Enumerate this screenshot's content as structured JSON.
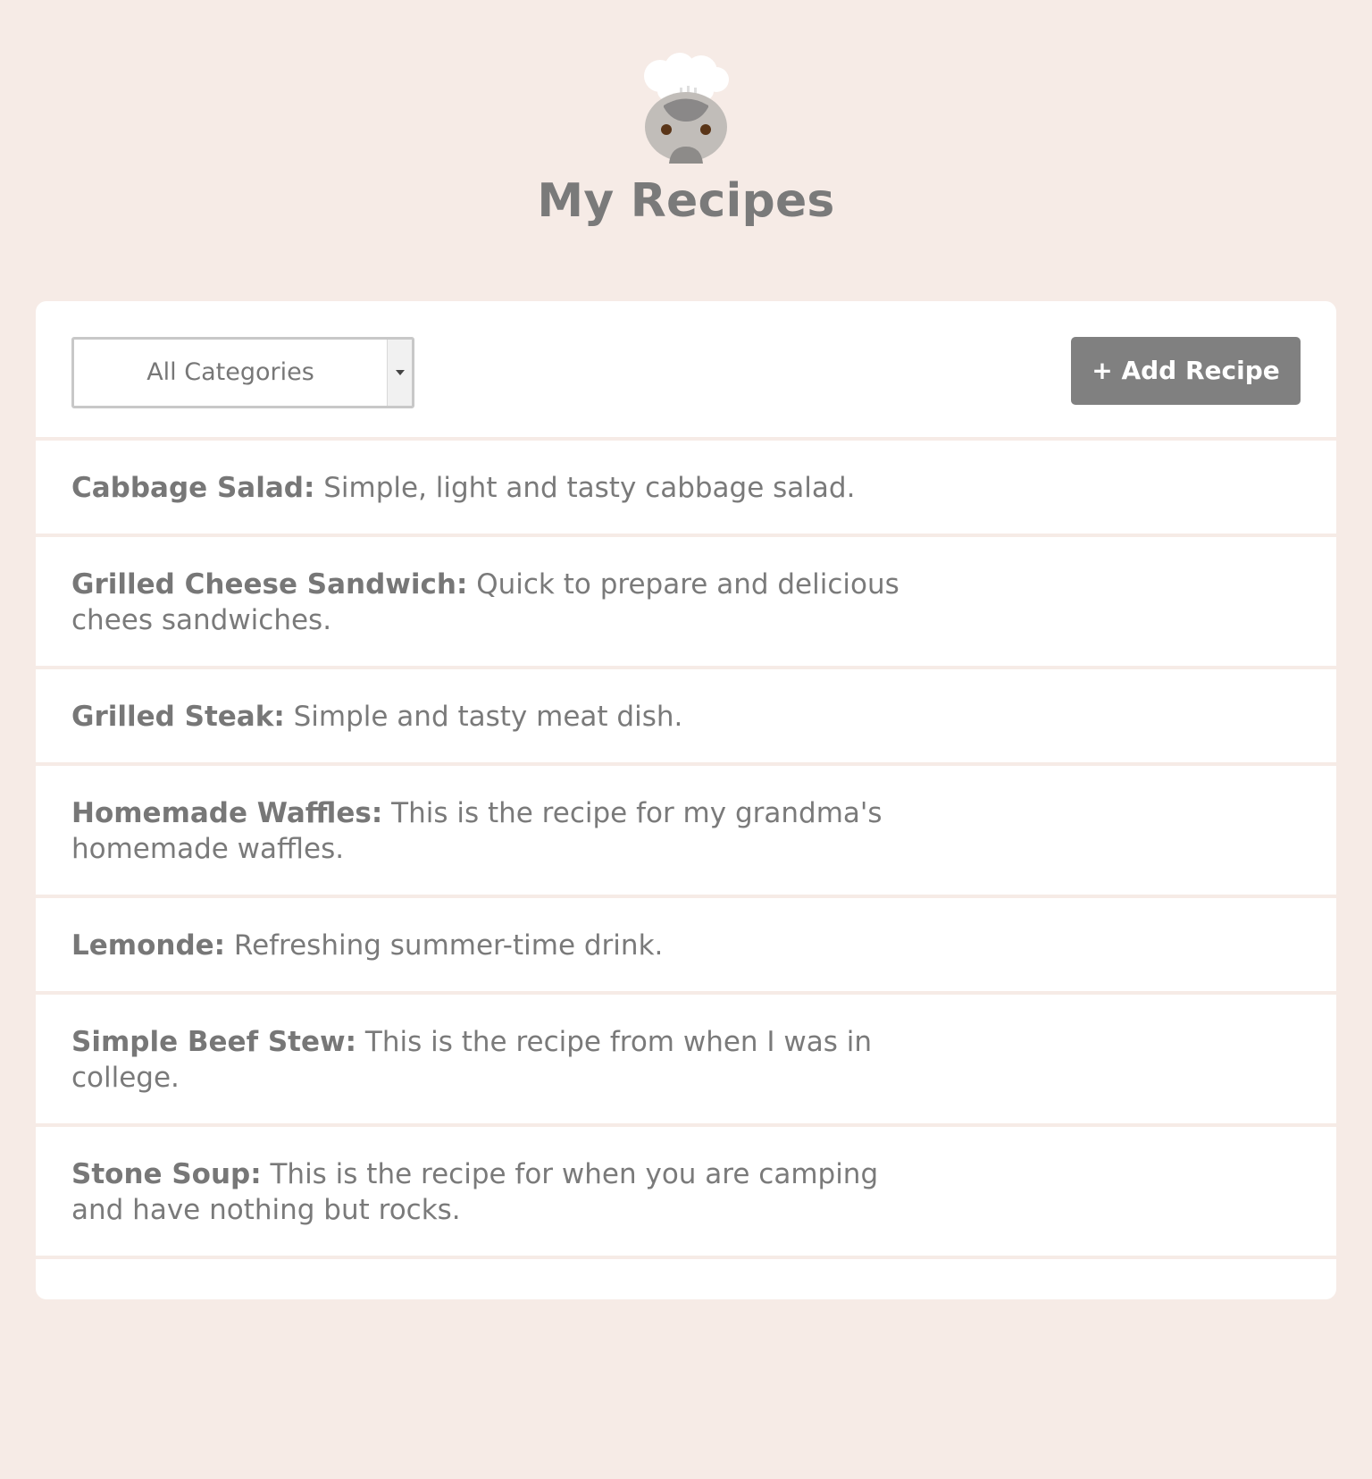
{
  "app": {
    "title": "My Recipes",
    "logo_icon": "chef-hat-icon"
  },
  "toolbar": {
    "category_filter": {
      "selected_label": "All Categories"
    },
    "add_recipe_label": "+ Add Recipe"
  },
  "recipes": [
    {
      "name": "Cabbage Salad:",
      "description": " Simple, light and tasty cabbage salad."
    },
    {
      "name": "Grilled Cheese Sandwich:",
      "description": " Quick to prepare and delicious chees sandwiches."
    },
    {
      "name": "Grilled Steak:",
      "description": " Simple and tasty meat dish."
    },
    {
      "name": "Homemade Waffles:",
      "description": " This is the recipe for my grandma's homemade waffles."
    },
    {
      "name": "Lemonde:",
      "description": " Refreshing summer-time drink."
    },
    {
      "name": "Simple Beef Stew:",
      "description": " This is the recipe from when I was in college."
    },
    {
      "name": "Stone Soup:",
      "description": " This is the recipe for when you are camping and have nothing but rocks."
    }
  ],
  "colors": {
    "page_background": "#f6ebe6",
    "card_background": "#ffffff",
    "button_background": "#808080",
    "text": "#7a7a7a"
  }
}
